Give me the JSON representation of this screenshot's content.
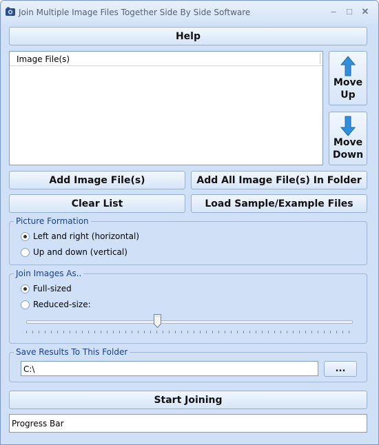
{
  "window": {
    "title": "Join Multiple Image Files Together Side By Side Software",
    "minimize_glyph": "–",
    "maximize_glyph": "□",
    "close_glyph": "✕"
  },
  "buttons": {
    "help": "Help",
    "move_up": "Move\nUp",
    "move_down": "Move\nDown",
    "add_files": "Add Image File(s)",
    "add_folder": "Add All Image File(s) In Folder",
    "clear_list": "Clear List",
    "load_sample": "Load Sample/Example Files",
    "browse": "...",
    "start": "Start Joining"
  },
  "file_list": {
    "column_header": "Image File(s)",
    "rows": []
  },
  "picture_formation": {
    "label": "Picture Formation",
    "options": [
      "Left and right (horizontal)",
      "Up and down (vertical)"
    ],
    "selected": 0
  },
  "join_as": {
    "label": "Join Images As..",
    "options": [
      "Full-sized",
      "Reduced-size:"
    ],
    "selected": 0,
    "slider_fraction": 0.4
  },
  "save_folder": {
    "label": "Save Results To This Folder",
    "value": "C:\\"
  },
  "progress": {
    "text": "Progress Bar"
  },
  "colors": {
    "accent": "#1a3e8a",
    "arrow": "#2f8fd8",
    "background": "#cfe0f7"
  }
}
